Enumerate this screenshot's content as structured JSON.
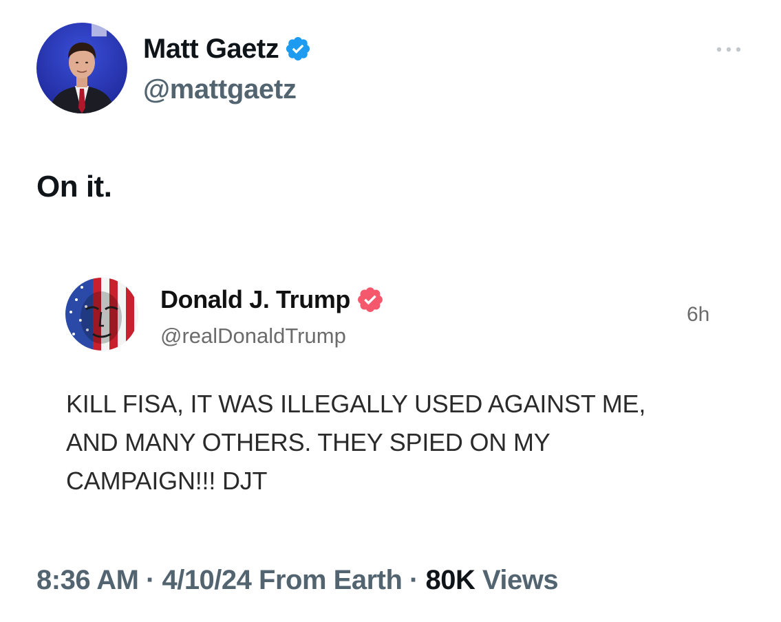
{
  "tweet": {
    "author": {
      "name": "Matt Gaetz",
      "handle": "@mattgaetz",
      "verified_color": "#1d9bf0"
    },
    "text": "On it.",
    "more_icon": "more-dots-icon",
    "meta": {
      "time": "8:36 AM",
      "sep1": " · ",
      "date": "4/10/24",
      "source": "From Earth",
      "sep2": " · ",
      "views_count": "80K",
      "views_label": "Views"
    }
  },
  "quoted_post": {
    "author": {
      "name": "Donald J. Trump",
      "handle": "@realDonaldTrump",
      "verified_color": "#f5576c"
    },
    "time_ago": "6h",
    "text_lines": [
      "KILL FISA, IT WAS ILLEGALLY USED AGAINST ME,",
      "AND MANY OTHERS. THEY SPIED ON MY",
      "CAMPAIGN!!! DJT"
    ]
  }
}
